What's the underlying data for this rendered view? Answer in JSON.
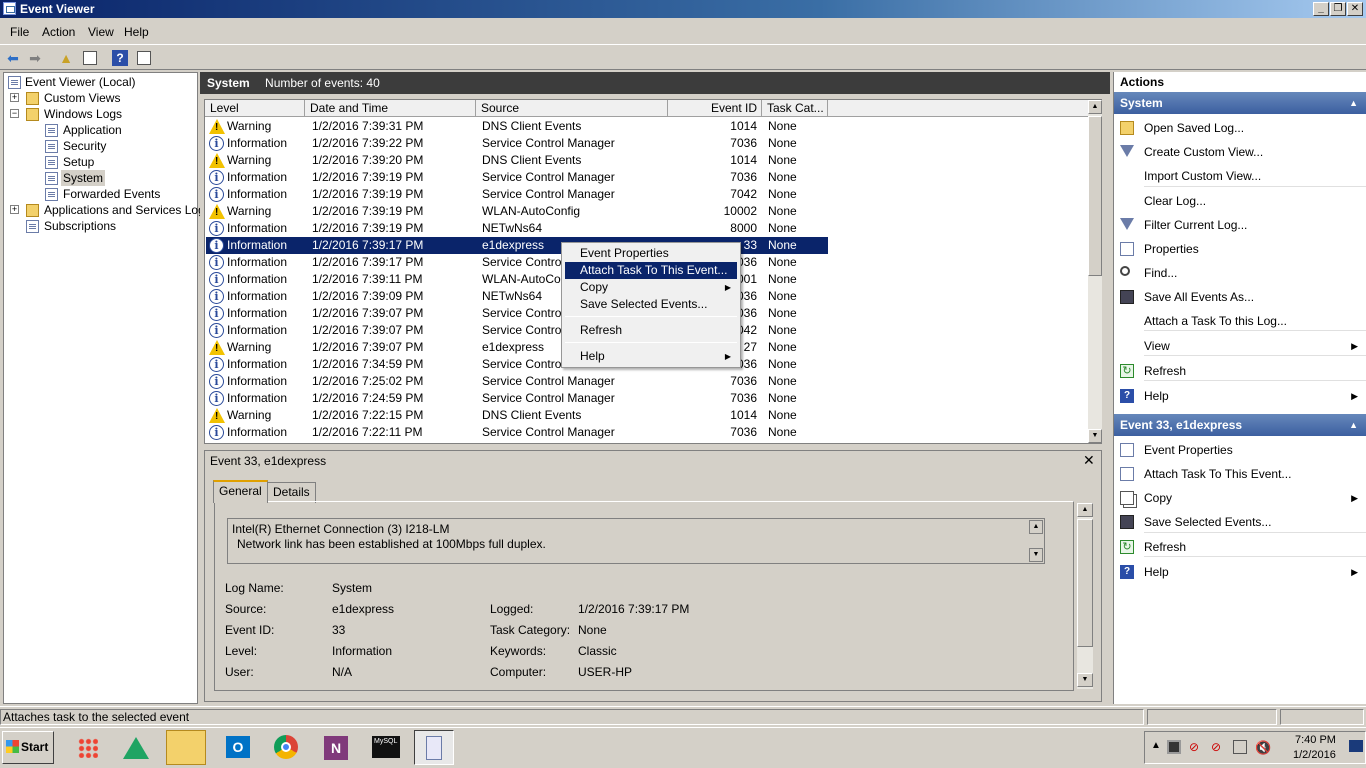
{
  "window": {
    "title": "Event Viewer",
    "minimize": "_",
    "maximize": "❐",
    "close": "✕"
  },
  "menu": [
    "File",
    "Action",
    "View",
    "Help"
  ],
  "tree": {
    "root": "Event Viewer (Local)",
    "custom_views": "Custom Views",
    "windows_logs": "Windows Logs",
    "application": "Application",
    "security": "Security",
    "setup": "Setup",
    "system": "System",
    "forwarded": "Forwarded Events",
    "apps_services": "Applications and Services Logs",
    "subscriptions": "Subscriptions"
  },
  "center_header": {
    "title": "System",
    "count": "Number of events: 40"
  },
  "columns": [
    "Level",
    "Date and Time",
    "Source",
    "Event ID",
    "Task Cat..."
  ],
  "events": [
    {
      "level": "Warning",
      "date": "1/2/2016 7:39:31 PM",
      "source": "DNS Client Events",
      "id": "1014",
      "task": "None"
    },
    {
      "level": "Information",
      "date": "1/2/2016 7:39:22 PM",
      "source": "Service Control Manager",
      "id": "7036",
      "task": "None"
    },
    {
      "level": "Warning",
      "date": "1/2/2016 7:39:20 PM",
      "source": "DNS Client Events",
      "id": "1014",
      "task": "None"
    },
    {
      "level": "Information",
      "date": "1/2/2016 7:39:19 PM",
      "source": "Service Control Manager",
      "id": "7036",
      "task": "None"
    },
    {
      "level": "Information",
      "date": "1/2/2016 7:39:19 PM",
      "source": "Service Control Manager",
      "id": "7042",
      "task": "None"
    },
    {
      "level": "Warning",
      "date": "1/2/2016 7:39:19 PM",
      "source": "WLAN-AutoConfig",
      "id": "10002",
      "task": "None"
    },
    {
      "level": "Information",
      "date": "1/2/2016 7:39:19 PM",
      "source": "NETwNs64",
      "id": "8000",
      "task": "None"
    },
    {
      "level": "Information",
      "date": "1/2/2016 7:39:17 PM",
      "source": "e1dexpress",
      "id": "33",
      "task": "None"
    },
    {
      "level": "Information",
      "date": "1/2/2016 7:39:17 PM",
      "source": "Service Control M",
      "id": "036",
      "task": "None"
    },
    {
      "level": "Information",
      "date": "1/2/2016 7:39:11 PM",
      "source": "WLAN-AutoConfi",
      "id": "001",
      "task": "None"
    },
    {
      "level": "Information",
      "date": "1/2/2016 7:39:09 PM",
      "source": "NETwNs64",
      "id": "036",
      "task": "None"
    },
    {
      "level": "Information",
      "date": "1/2/2016 7:39:07 PM",
      "source": "Service Control M",
      "id": "036",
      "task": "None"
    },
    {
      "level": "Information",
      "date": "1/2/2016 7:39:07 PM",
      "source": "Service Control M",
      "id": "042",
      "task": "None"
    },
    {
      "level": "Warning",
      "date": "1/2/2016 7:39:07 PM",
      "source": "e1dexpress",
      "id": "27",
      "task": "None"
    },
    {
      "level": "Information",
      "date": "1/2/2016 7:34:59 PM",
      "source": "Service Control M",
      "id": "036",
      "task": "None"
    },
    {
      "level": "Information",
      "date": "1/2/2016 7:25:02 PM",
      "source": "Service Control Manager",
      "id": "7036",
      "task": "None"
    },
    {
      "level": "Information",
      "date": "1/2/2016 7:24:59 PM",
      "source": "Service Control Manager",
      "id": "7036",
      "task": "None"
    },
    {
      "level": "Warning",
      "date": "1/2/2016 7:22:15 PM",
      "source": "DNS Client Events",
      "id": "1014",
      "task": "None"
    },
    {
      "level": "Information",
      "date": "1/2/2016 7:22:11 PM",
      "source": "Service Control Manager",
      "id": "7036",
      "task": "None"
    }
  ],
  "context_menu": {
    "event_properties": "Event Properties",
    "attach_task": "Attach Task To This Event...",
    "copy": "Copy",
    "save_selected": "Save Selected Events...",
    "refresh": "Refresh",
    "help": "Help"
  },
  "detail": {
    "title": "Event 33, e1dexpress",
    "close": "✕",
    "tab_general": "General",
    "tab_details": "Details",
    "desc_line1": "Intel(R) Ethernet Connection (3) I218-LM",
    "desc_line2": "Network link has been established at 100Mbps full duplex.",
    "log_name_label": "Log Name:",
    "log_name": "System",
    "source_label": "Source:",
    "source": "e1dexpress",
    "logged_label": "Logged:",
    "logged": "1/2/2016 7:39:17 PM",
    "event_id_label": "Event ID:",
    "event_id": "33",
    "task_cat_label": "Task Category:",
    "task_cat": "None",
    "level_label": "Level:",
    "level": "Information",
    "keywords_label": "Keywords:",
    "keywords": "Classic",
    "user_label": "User:",
    "user": "N/A",
    "computer_label": "Computer:",
    "computer": "USER-HP"
  },
  "actions": {
    "header": "Actions",
    "section1": "System",
    "items1": [
      "Open Saved Log...",
      "Create Custom View...",
      "Import Custom View...",
      "Clear Log...",
      "Filter Current Log...",
      "Properties",
      "Find...",
      "Save All Events As...",
      "Attach a Task To this Log...",
      "View",
      "Refresh",
      "Help"
    ],
    "section2": "Event 33, e1dexpress",
    "items2": [
      "Event Properties",
      "Attach Task To This Event...",
      "Copy",
      "Save Selected Events...",
      "Refresh",
      "Help"
    ]
  },
  "status": "Attaches task to the selected event",
  "taskbar": {
    "start": "Start",
    "time": "7:40 PM",
    "date": "1/2/2016"
  },
  "colors": {
    "selection": "#0a246a",
    "section_header": "#3c5fa0",
    "warning": "#f2c200"
  }
}
